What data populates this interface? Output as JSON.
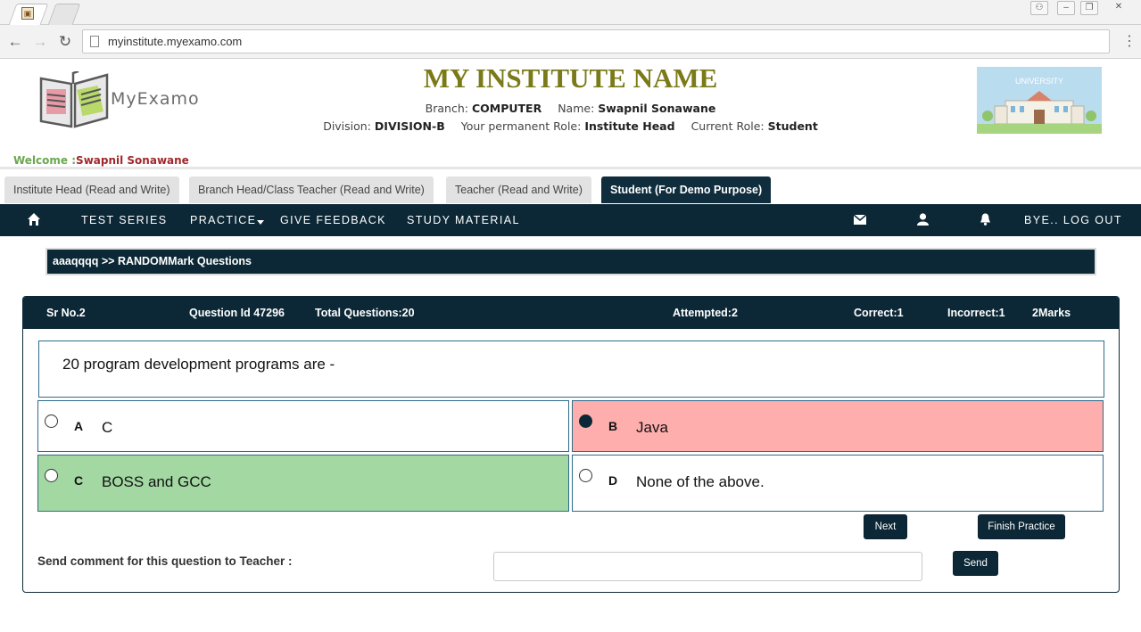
{
  "browser": {
    "url": "myinstitute.myexamo.com"
  },
  "header": {
    "logo_text": "MyExamo",
    "institute_name": "MY INSTITUTE NAME",
    "branch_label": "Branch:",
    "branch_value": "COMPUTER",
    "name_label": "Name:",
    "name_value": "Swapnil Sonawane",
    "division_label": "Division:",
    "division_value": "DIVISION-B",
    "perm_role_label": "Your permanent Role:",
    "perm_role_value": "Institute Head",
    "current_role_label": "Current Role:",
    "current_role_value": "Student",
    "university_image_text": "UNIVERSITY",
    "welcome_label": "Welcome :",
    "welcome_name": "Swapnil Sonawane"
  },
  "role_tabs": [
    {
      "label": "Institute Head (Read and Write)"
    },
    {
      "label": "Branch Head/Class Teacher (Read and Write)"
    },
    {
      "label": "Teacher (Read and Write)"
    },
    {
      "label": "Student (For Demo Purpose)"
    }
  ],
  "nav": {
    "test_series": "TEST SERIES",
    "practice": "PRACTICE",
    "feedback": "GIVE FEEDBACK",
    "study_material": "STUDY MATERIAL",
    "logout": "BYE.. LOG OUT"
  },
  "breadcrumb": "aaaqqqq >> RANDOMMark Questions",
  "question_panel": {
    "sr_no": "Sr No.2",
    "question_id": "Question Id 47296",
    "total": "Total Questions:20",
    "attempted": "Attempted:2",
    "correct": "Correct:1",
    "incorrect": "Incorrect:1",
    "marks": "2Marks",
    "question_text": "20 program development programs are -",
    "options": [
      {
        "letter": "A",
        "text": "C",
        "state": "none"
      },
      {
        "letter": "B",
        "text": "Java",
        "state": "selected-wrong"
      },
      {
        "letter": "C",
        "text": "BOSS and GCC",
        "state": "correct"
      },
      {
        "letter": "D",
        "text": "None of the above.",
        "state": "none"
      }
    ],
    "next_label": "Next",
    "finish_label": "Finish Practice",
    "comment_label": "Send comment for this question to Teacher :",
    "comment_value": "",
    "send_label": "Send"
  },
  "colors": {
    "nav_bg": "#0c2836",
    "title": "#7a7a18",
    "wrong": "#ffaeae",
    "correct": "#a3d8a3"
  }
}
